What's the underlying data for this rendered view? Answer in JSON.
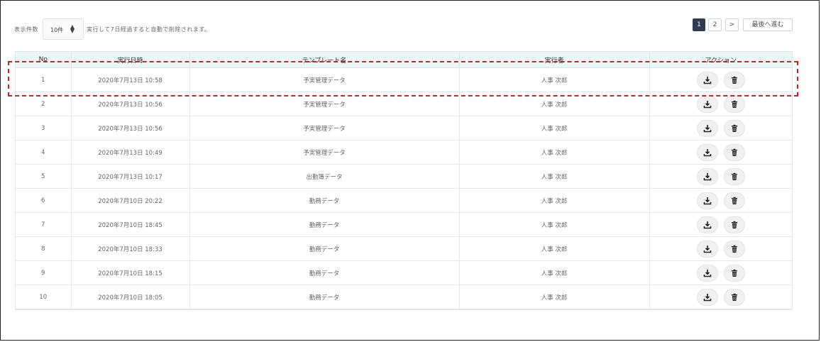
{
  "toolbar": {
    "per_page_label": "表示件数",
    "per_page_value": "10件",
    "retention_note": "実行して7日経過すると自動で削除されます。"
  },
  "pagination": {
    "pages": [
      "1",
      "2"
    ],
    "current": "1",
    "next": ">",
    "last": "最後へ進む"
  },
  "table": {
    "columns": [
      "No",
      "実行日時",
      "テンプレート名",
      "実行者",
      "アクション"
    ],
    "rows": [
      {
        "no": "1",
        "datetime": "2020年7月13日 10:58",
        "template": "予実管理データ",
        "user": "人事 次郎"
      },
      {
        "no": "2",
        "datetime": "2020年7月13日 10:56",
        "template": "予実管理データ",
        "user": "人事 次郎"
      },
      {
        "no": "3",
        "datetime": "2020年7月13日 10:56",
        "template": "予実管理データ",
        "user": "人事 次郎"
      },
      {
        "no": "4",
        "datetime": "2020年7月13日 10:49",
        "template": "予実管理データ",
        "user": "人事 次郎"
      },
      {
        "no": "5",
        "datetime": "2020年7月13日 10:17",
        "template": "出勤簿データ",
        "user": "人事 次郎"
      },
      {
        "no": "6",
        "datetime": "2020年7月10日 20:22",
        "template": "勤務データ",
        "user": "人事 次郎"
      },
      {
        "no": "7",
        "datetime": "2020年7月10日 18:45",
        "template": "勤務データ",
        "user": "人事 次郎"
      },
      {
        "no": "8",
        "datetime": "2020年7月10日 18:33",
        "template": "勤務データ",
        "user": "人事 次郎"
      },
      {
        "no": "9",
        "datetime": "2020年7月10日 18:15",
        "template": "勤務データ",
        "user": "人事 次郎"
      },
      {
        "no": "10",
        "datetime": "2020年7月10日 18:05",
        "template": "勤務データ",
        "user": "人事 次郎"
      }
    ],
    "actions": {
      "download_icon": "download-icon",
      "delete_icon": "trash-icon"
    }
  },
  "colors": {
    "header_bg": "#e9f7f7",
    "active_page_bg": "#2e3c4f",
    "highlight_border": "#d0201f"
  }
}
